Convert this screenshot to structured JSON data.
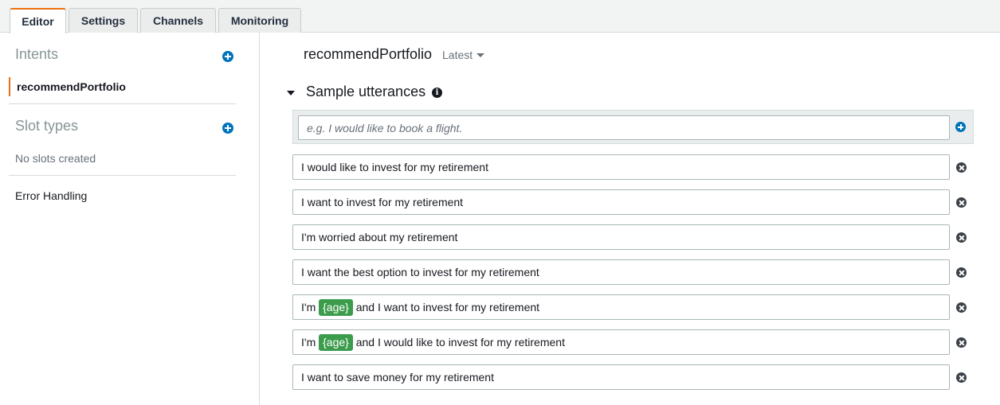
{
  "tabs": [
    {
      "label": "Editor",
      "active": true
    },
    {
      "label": "Settings",
      "active": false
    },
    {
      "label": "Channels",
      "active": false
    },
    {
      "label": "Monitoring",
      "active": false
    }
  ],
  "sidebar": {
    "intents_heading": "Intents",
    "intents": [
      "recommendPortfolio"
    ],
    "slot_types_heading": "Slot types",
    "slot_types_empty": "No slots created",
    "error_handling": "Error Handling"
  },
  "main": {
    "intent_name": "recommendPortfolio",
    "version": "Latest",
    "section_title": "Sample utterances",
    "utterance_placeholder": "e.g. I would like to book a flight.",
    "utterances": [
      {
        "before": "I would like to invest for my retirement",
        "slot": "",
        "after": ""
      },
      {
        "before": "I want to invest for my retirement",
        "slot": "",
        "after": ""
      },
      {
        "before": "I'm worried about my retirement",
        "slot": "",
        "after": ""
      },
      {
        "before": "I want the best option to invest for my retirement",
        "slot": "",
        "after": ""
      },
      {
        "before": "I'm ",
        "slot": "{age}",
        "after": " and I want to invest for my retirement"
      },
      {
        "before": "I'm ",
        "slot": "{age}",
        "after": " and I would like to invest for my retirement"
      },
      {
        "before": "I want to save money for my retirement",
        "slot": "",
        "after": ""
      }
    ]
  },
  "colors": {
    "accent": "#ec7211",
    "add_icon": "#0073bb",
    "slot_chip": "#3b9c4c"
  }
}
